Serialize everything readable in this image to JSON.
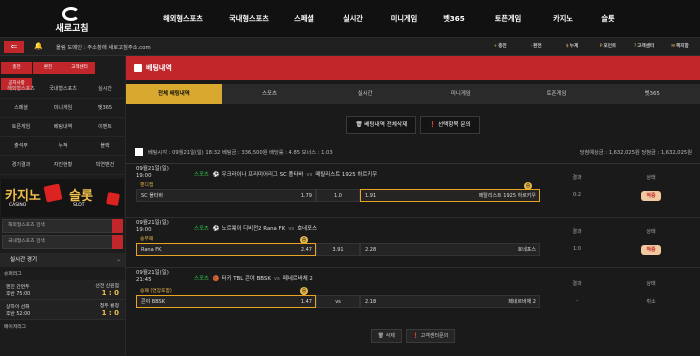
{
  "brand": {
    "name": "새로고침"
  },
  "nav": [
    "해외형스포츠",
    "국내형스포츠",
    "스페셜",
    "실시간",
    "미니게임",
    "벳365",
    "토픈게임",
    "카지노",
    "슬롯"
  ],
  "notice": "올림 도메인 : 주소창에 새로고침주소.com",
  "quick": [
    {
      "icon": "+",
      "label": "충전"
    },
    {
      "icon": "-",
      "label": "환전"
    },
    {
      "icon": "$",
      "label": "누계"
    },
    {
      "icon": "P",
      "label": "포인트"
    },
    {
      "icon": "?",
      "label": "고객센터"
    },
    {
      "icon": "✉",
      "label": "쪽지함"
    }
  ],
  "side_buttons": [
    "충전",
    "환전",
    "고객센터",
    "공지사항"
  ],
  "side_grid": [
    "해외형스포츠",
    "국내형스포츠",
    "실시간",
    "스페셜",
    "미니게임",
    "벳365",
    "토픈게임",
    "베팅내역",
    "이벤트",
    "출석부",
    "누적",
    "블랙",
    "경기결과",
    "자진현황",
    "빅연맨건"
  ],
  "casino": {
    "left": "카지노",
    "left_sub": "CASINO",
    "right": "슬롯",
    "right_sub": "SLOT"
  },
  "search": [
    "해외형스포츠 검색",
    "국내형스포츠 검색"
  ],
  "live": {
    "header": "실시간 경기",
    "section1": "슈퍼리그",
    "match1": {
      "home": "맨진 간먼두",
      "away": "선전 신원점",
      "time": "후반 75:00",
      "score": "1 : 0"
    },
    "match2": {
      "home": "상하이 선화",
      "away": "청두 룡청",
      "time": "후반 52:00",
      "score": "1 : 0"
    },
    "section2": "메이저리그"
  },
  "page_title": "베팅내역",
  "tabs": [
    "전체 배팅내역",
    "스포츠",
    "실시간",
    "미니게임",
    "토픈게임",
    "벳365"
  ],
  "actions": [
    "베팅내역 전체삭제",
    "선택항목 문의"
  ],
  "bet_summary": {
    "left": "베팅시각 : 09월21일(일) 18:32    베팅금 : 336,500원    배당률 : 4.85    보너스 : 1.03",
    "right": "당첨예상금 : 1,632,025원    당첨금 : 1,632,025원"
  },
  "bets": [
    {
      "date": "09월21일(일)",
      "time": "19:00",
      "sport": "스포츠",
      "league": "우크라이나 프리미어리그",
      "home": "SC 폴타바",
      "vs": "vs",
      "away": "메탈리스트 1925 하르키우",
      "market": "핸디캡",
      "home_name": "SC 폴타바",
      "home_odds": "1.79",
      "line": "1.0",
      "away_odds": "1.91",
      "away_name": "메탈리스트 1925 하르키우",
      "result_label": "결과",
      "result": "0:2",
      "status_label": "상태",
      "status": "적중",
      "coin": "승"
    },
    {
      "date": "09월21일(일)",
      "time": "19:00",
      "sport": "스포츠",
      "league": "노르웨이 디비전2",
      "home": "Rana FK",
      "vs": "vs",
      "away": "호네포스",
      "market": "승무패",
      "home_name": "Rana FK",
      "home_odds": "2.47",
      "line": "3.91",
      "away_odds": "2.28",
      "away_name": "호네포스",
      "result_label": "결과",
      "result": "1:0",
      "status_label": "상태",
      "status": "적중",
      "coin": "승"
    },
    {
      "date": "09월21일(일)",
      "time": "21:45",
      "sport": "스포츠",
      "league": "터키 TBL",
      "home": "콘야 BBSK",
      "vs": "vs",
      "away": "페네르바체 2",
      "market": "승패 (연장포함)",
      "home_name": "콘야 BBSK",
      "home_odds": "1.47",
      "line": "vs",
      "away_odds": "2.18",
      "away_name": "페네르바체 2",
      "result_label": "결과",
      "result": "-",
      "status_label": "상태",
      "status": "취소",
      "coin": "승"
    }
  ],
  "footer": [
    "삭제",
    "고객센터문의"
  ]
}
